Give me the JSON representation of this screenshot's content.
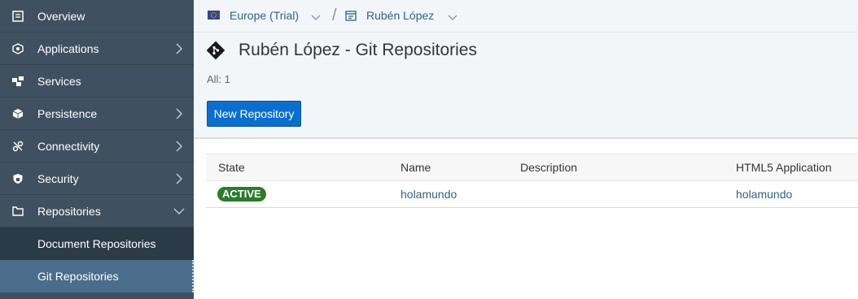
{
  "sidebar": {
    "items": [
      {
        "label": "Overview",
        "icon": "overview-icon"
      },
      {
        "label": "Applications",
        "icon": "applications-icon"
      },
      {
        "label": "Services",
        "icon": "services-icon"
      },
      {
        "label": "Persistence",
        "icon": "persistence-icon"
      },
      {
        "label": "Connectivity",
        "icon": "connectivity-icon"
      },
      {
        "label": "Security",
        "icon": "security-icon"
      },
      {
        "label": "Repositories",
        "icon": "repositories-icon"
      }
    ],
    "subitems": [
      {
        "label": "Document Repositories"
      },
      {
        "label": "Git Repositories"
      }
    ]
  },
  "breadcrumb": {
    "region": "Europe (Trial)",
    "separator": "/",
    "account": "Rubén López"
  },
  "header": {
    "title": "Rubén López - Git Repositories",
    "count": "All: 1",
    "new_button": "New Repository"
  },
  "table": {
    "columns": [
      "State",
      "Name",
      "Description",
      "HTML5 Application"
    ],
    "rows": [
      {
        "state": "ACTIVE",
        "name": "holamundo",
        "description": "",
        "html5_app": "holamundo"
      }
    ]
  },
  "colors": {
    "sidebar_bg": "#3f5161",
    "active_item": "#4a6d8b",
    "primary_button": "#0a6ed1",
    "status_active": "#2b7d2b",
    "link": "#346187"
  }
}
